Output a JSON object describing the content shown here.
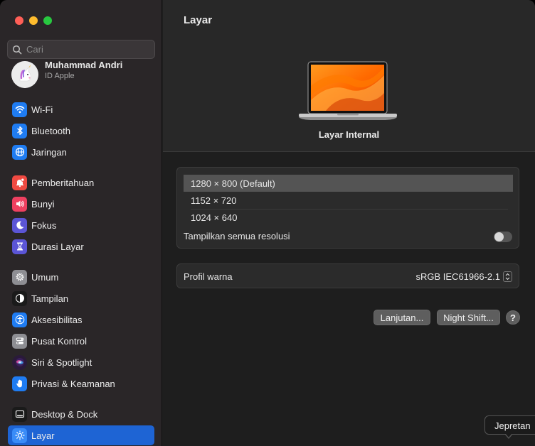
{
  "window": {
    "title": "Layar"
  },
  "search": {
    "placeholder": "Cari"
  },
  "profile": {
    "name": "Muhammad Andri",
    "subtitle": "ID Apple"
  },
  "sidebar": {
    "items": [
      {
        "id": "wifi",
        "label": "Wi-Fi",
        "icon": "wifi-icon",
        "color": "#1f7cf2"
      },
      {
        "id": "bluetooth",
        "label": "Bluetooth",
        "icon": "bluetooth-icon",
        "color": "#1f7cf2"
      },
      {
        "id": "network",
        "label": "Jaringan",
        "icon": "globe-icon",
        "color": "#1f7cf2"
      },
      {
        "id": "notifications",
        "label": "Pemberitahuan",
        "icon": "bell-icon",
        "color": "#f04a42"
      },
      {
        "id": "sound",
        "label": "Bunyi",
        "icon": "speaker-icon",
        "color": "#ee4060"
      },
      {
        "id": "focus",
        "label": "Fokus",
        "icon": "moon-icon",
        "color": "#5b55d6"
      },
      {
        "id": "screentime",
        "label": "Durasi Layar",
        "icon": "hourglass-icon",
        "color": "#5b55d6"
      },
      {
        "id": "general",
        "label": "Umum",
        "icon": "gear-icon",
        "color": "#8e8e93"
      },
      {
        "id": "appearance",
        "label": "Tampilan",
        "icon": "appearance-icon",
        "color": "#1a1a1a"
      },
      {
        "id": "accessibility",
        "label": "Aksesibilitas",
        "icon": "accessibility-icon",
        "color": "#1f7cf2"
      },
      {
        "id": "controlcenter",
        "label": "Pusat Kontrol",
        "icon": "control-center-icon",
        "color": "#8e8e93"
      },
      {
        "id": "siri",
        "label": "Siri & Spotlight",
        "icon": "siri-icon",
        "color": "#2a1a3a"
      },
      {
        "id": "privacy",
        "label": "Privasi & Keamanan",
        "icon": "hand-icon",
        "color": "#1f7cf2"
      },
      {
        "id": "desktop",
        "label": "Desktop & Dock",
        "icon": "dock-icon",
        "color": "#1a1a1a"
      },
      {
        "id": "displays",
        "label": "Layar",
        "icon": "sun-icon",
        "color": "#1f7cf2",
        "active": true
      }
    ]
  },
  "display": {
    "name": "Layar Internal"
  },
  "resolutions": {
    "options": [
      "1280 × 800 (Default)",
      "1152 × 720",
      "1024 × 640"
    ],
    "selected": "1280 × 800 (Default)",
    "show_all_label": "Tampilkan semua resolusi",
    "show_all_on": false
  },
  "color_profile": {
    "label": "Profil warna",
    "value": "sRGB IEC61966-2.1"
  },
  "buttons": {
    "advanced": "Lanjutan...",
    "night_shift": "Night Shift...",
    "help": "?"
  },
  "tooltip": {
    "text": "Jepretan"
  }
}
